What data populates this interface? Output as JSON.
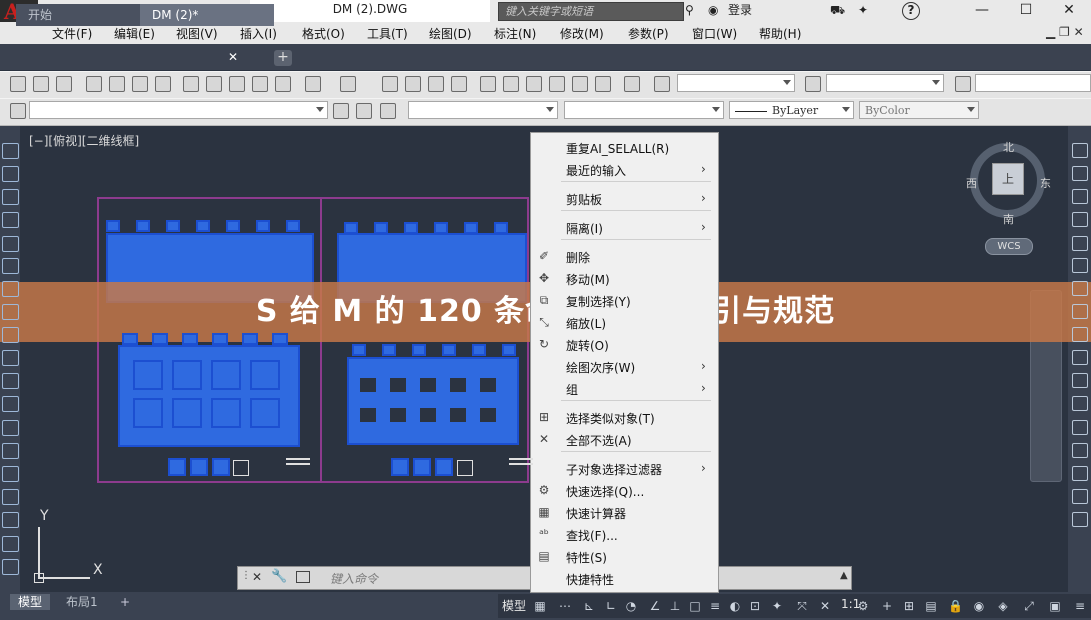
{
  "window": {
    "document_title": "DM (2).DWG",
    "search_placeholder": "键入关键字或短语",
    "login_label": "登录",
    "help_label": "?",
    "minimize": "—",
    "maximize": "☐",
    "close": "✕"
  },
  "menubar": [
    "文件(F)",
    "编辑(E)",
    "视图(V)",
    "插入(I)",
    "格式(O)",
    "工具(T)",
    "绘图(D)",
    "标注(N)",
    "修改(M)",
    "参数(P)",
    "窗口(W)",
    "帮助(H)"
  ],
  "tabs": {
    "start": "开始",
    "document": "DM (2)*",
    "add": "+"
  },
  "toolbar": {
    "linetype": "ByLayer",
    "color": "ByColor"
  },
  "viewport_label": "[−][俯视][二维线框]",
  "viewcube": {
    "north": "北",
    "south": "南",
    "east": "东",
    "west": "西",
    "top_face": "上",
    "wcs": "WCS"
  },
  "ucs": {
    "x": "X",
    "y": "Y"
  },
  "context_menu": {
    "items": [
      {
        "label": "重复AI_SELALL(R)",
        "submenu": false,
        "icon": ""
      },
      {
        "label": "最近的输入",
        "submenu": true,
        "icon": ""
      },
      {
        "label": "剪贴板",
        "submenu": true,
        "icon": ""
      },
      {
        "label": "隔离(I)",
        "submenu": true,
        "icon": ""
      },
      {
        "label": "删除",
        "submenu": false,
        "icon": "erase-icon"
      },
      {
        "label": "移动(M)",
        "submenu": false,
        "icon": "move-icon"
      },
      {
        "label": "复制选择(Y)",
        "submenu": false,
        "icon": "copy-icon"
      },
      {
        "label": "缩放(L)",
        "submenu": false,
        "icon": "scale-icon"
      },
      {
        "label": "旋转(O)",
        "submenu": false,
        "icon": "rotate-icon"
      },
      {
        "label": "绘图次序(W)",
        "submenu": true,
        "icon": ""
      },
      {
        "label": "组",
        "submenu": true,
        "icon": ""
      },
      {
        "label": "选择类似对象(T)",
        "submenu": false,
        "icon": "select-similar-icon"
      },
      {
        "label": "全部不选(A)",
        "submenu": false,
        "icon": "deselect-icon"
      },
      {
        "label": "子对象选择过滤器",
        "submenu": true,
        "icon": ""
      },
      {
        "label": "快速选择(Q)...",
        "submenu": false,
        "icon": "quick-select-icon"
      },
      {
        "label": "快速计算器",
        "submenu": false,
        "icon": "calculator-icon"
      },
      {
        "label": "查找(F)...",
        "submenu": false,
        "icon": "find-icon"
      },
      {
        "label": "特性(S)",
        "submenu": false,
        "icon": "properties-icon"
      },
      {
        "label": "快捷特性",
        "submenu": false,
        "icon": ""
      }
    ]
  },
  "command_line": {
    "placeholder": "键入命令"
  },
  "status": {
    "model_tab": "模型",
    "layout_tab": "布局1",
    "add": "+",
    "model_label": "模型",
    "scale": "1:1"
  },
  "banner": "S 给 M 的 120 条命令：详细指引与规范",
  "colors": {
    "accent": "#c7784a",
    "drawing_blue": "#2f6ae0",
    "frame_purple": "#8d3b8e",
    "background": "#2b3340"
  }
}
